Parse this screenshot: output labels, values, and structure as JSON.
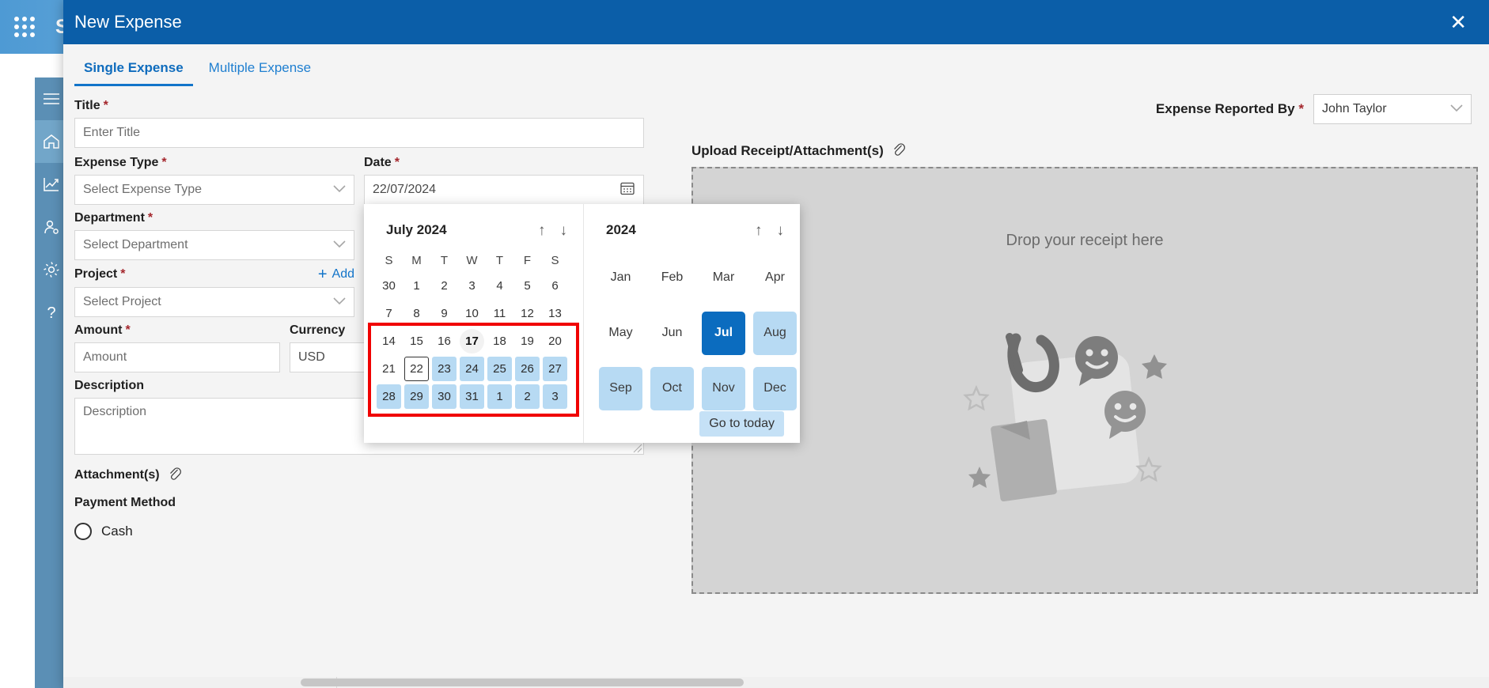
{
  "app": {
    "brand": "S",
    "waffle_icon": "app-launcher-icon",
    "rail": [
      {
        "name": "hamburger-menu",
        "icon": "hamburger-icon",
        "active": false
      },
      {
        "name": "home",
        "icon": "home-icon",
        "active": true
      },
      {
        "name": "analytics",
        "icon": "chart-line-icon",
        "active": false
      },
      {
        "name": "user-admin",
        "icon": "user-gear-icon",
        "active": false
      },
      {
        "name": "settings",
        "icon": "gear-icon",
        "active": false
      },
      {
        "name": "help",
        "icon": "question-mark-icon",
        "active": false
      }
    ]
  },
  "modal": {
    "title": "New Expense",
    "close_label": "✕",
    "close_icon": "close-icon"
  },
  "tabs": [
    {
      "label": "Single Expense",
      "active": true
    },
    {
      "label": "Multiple Expense",
      "active": false
    }
  ],
  "form": {
    "title": {
      "label": "Title",
      "required": "*",
      "placeholder": "Enter Title",
      "value": ""
    },
    "expense_type": {
      "label": "Expense Type",
      "required": "*",
      "value": "Select Expense Type"
    },
    "date": {
      "label": "Date",
      "required": "*",
      "value": "22/07/2024",
      "icon": "calendar-icon"
    },
    "department": {
      "label": "Department",
      "required": "*",
      "value": "Select Department"
    },
    "project": {
      "label": "Project",
      "required": "*",
      "value": "Select Project",
      "add_label": "Add",
      "add_plus": "+"
    },
    "amount": {
      "label": "Amount",
      "required": "*",
      "placeholder": "Amount",
      "value": ""
    },
    "currency": {
      "label": "Currency",
      "value": "USD"
    },
    "description": {
      "label": "Description",
      "placeholder": "Description",
      "value": ""
    },
    "attachments": {
      "label": "Attachment(s)",
      "icon": "paperclip-icon"
    },
    "payment_method": {
      "label": "Payment Method",
      "options": [
        {
          "label": "Cash",
          "selected": false
        }
      ]
    }
  },
  "right": {
    "reported_by": {
      "label": "Expense Reported By",
      "required": "*",
      "value": "John Taylor"
    },
    "upload": {
      "label": "Upload Receipt/Attachment(s)",
      "icon": "paperclip-icon"
    },
    "dropzone": {
      "text": "Drop your receipt here",
      "illustration": "receipt-upload-illustration"
    }
  },
  "calendar": {
    "month_title": "July 2024",
    "year_title": "2024",
    "nav": {
      "up": "↑",
      "down": "↓"
    },
    "dow": [
      "S",
      "M",
      "T",
      "W",
      "T",
      "F",
      "S"
    ],
    "weeks": [
      [
        {
          "d": "30",
          "state": "out"
        },
        {
          "d": "1",
          "state": ""
        },
        {
          "d": "2",
          "state": ""
        },
        {
          "d": "3",
          "state": ""
        },
        {
          "d": "4",
          "state": ""
        },
        {
          "d": "5",
          "state": ""
        },
        {
          "d": "6",
          "state": ""
        }
      ],
      [
        {
          "d": "7",
          "state": ""
        },
        {
          "d": "8",
          "state": ""
        },
        {
          "d": "9",
          "state": ""
        },
        {
          "d": "10",
          "state": ""
        },
        {
          "d": "11",
          "state": ""
        },
        {
          "d": "12",
          "state": ""
        },
        {
          "d": "13",
          "state": ""
        }
      ],
      [
        {
          "d": "14",
          "state": ""
        },
        {
          "d": "15",
          "state": ""
        },
        {
          "d": "16",
          "state": ""
        },
        {
          "d": "17",
          "state": "today"
        },
        {
          "d": "18",
          "state": ""
        },
        {
          "d": "19",
          "state": ""
        },
        {
          "d": "20",
          "state": ""
        }
      ],
      [
        {
          "d": "21",
          "state": ""
        },
        {
          "d": "22",
          "state": "sel"
        },
        {
          "d": "23",
          "state": "hl"
        },
        {
          "d": "24",
          "state": "hl"
        },
        {
          "d": "25",
          "state": "hl"
        },
        {
          "d": "26",
          "state": "hl"
        },
        {
          "d": "27",
          "state": "hl"
        }
      ],
      [
        {
          "d": "28",
          "state": "hl"
        },
        {
          "d": "29",
          "state": "hl"
        },
        {
          "d": "30",
          "state": "hl"
        },
        {
          "d": "31",
          "state": "hl"
        },
        {
          "d": "1",
          "state": "hl"
        },
        {
          "d": "2",
          "state": "hl"
        },
        {
          "d": "3",
          "state": "hl"
        }
      ]
    ],
    "months": [
      {
        "m": "Jan",
        "state": ""
      },
      {
        "m": "Feb",
        "state": ""
      },
      {
        "m": "Mar",
        "state": ""
      },
      {
        "m": "Apr",
        "state": ""
      },
      {
        "m": "May",
        "state": ""
      },
      {
        "m": "Jun",
        "state": ""
      },
      {
        "m": "Jul",
        "state": "cur"
      },
      {
        "m": "Aug",
        "state": "hl"
      },
      {
        "m": "Sep",
        "state": "hl"
      },
      {
        "m": "Oct",
        "state": "hl"
      },
      {
        "m": "Nov",
        "state": "hl"
      },
      {
        "m": "Dec",
        "state": "hl"
      }
    ],
    "go_to_today": "Go to today",
    "highlight_box_color": "#f00202"
  },
  "colors": {
    "header_blue": "#0b5ea8",
    "accent_blue": "#1274c9",
    "selected_month": "#0b6cbf",
    "highlight_light": "#b7daf3",
    "required_red": "#a4262c",
    "annotation_red": "#f00202",
    "rail_blue": "#5b8fb5"
  }
}
